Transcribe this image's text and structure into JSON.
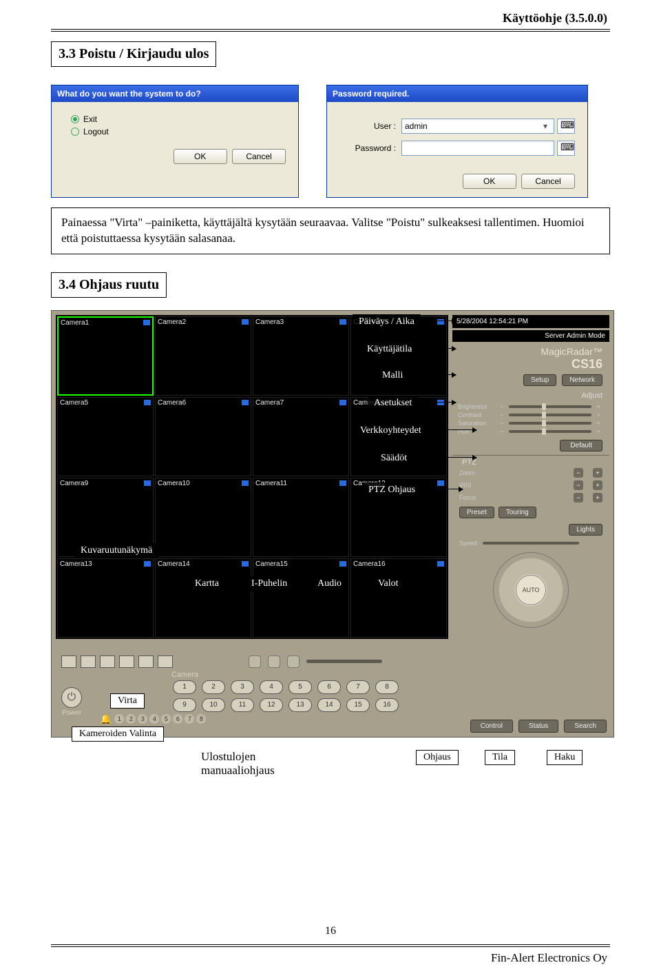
{
  "page": {
    "header": "Käyttöohje (3.5.0.0)",
    "footer": "Fin-Alert Electronics Oy",
    "number": "16"
  },
  "section1": {
    "title": "3.3 Poistu / Kirjaudu ulos"
  },
  "dialog1": {
    "title": "What do you want the system to do?",
    "opt1": "Exit",
    "opt2": "Logout",
    "ok": "OK",
    "cancel": "Cancel"
  },
  "dialog2": {
    "title": "Password required.",
    "user_label": "User :",
    "user_value": "admin",
    "pwd_label": "Password :",
    "ok": "OK",
    "cancel": "Cancel"
  },
  "paragraph": "Painaessa \"Virta\" –painiketta, käyttäjältä kysytään seuraavaa. Valitse \"Poistu\" sulkeaksesi tallentimen. Huomioi että poistuttaessa kysytään salasanaa.",
  "section2": {
    "title": "3.4 Ohjaus ruutu"
  },
  "dvr": {
    "datetime": "5/28/2004 12:54:21 PM",
    "mode": "Server Admin Mode",
    "brand1": "MagicRadar™",
    "brand2": "CS16",
    "btn_setup": "Setup",
    "btn_network": "Network",
    "adjust": "Adjust",
    "sliders": [
      "Brightness",
      "Contrast",
      "Saturation",
      "Hue"
    ],
    "default": "Default",
    "ptz": "PTZ",
    "ptz_rows": [
      "Zoom",
      "IRIS",
      "Focus"
    ],
    "pill_preset": "Preset",
    "pill_touring": "Touring",
    "pill_lights": "Lights",
    "speed": "Speed",
    "auto": "AUTO",
    "cam_label": "Camera",
    "cam_nums_top": [
      "1",
      "2",
      "3",
      "4",
      "5",
      "6",
      "7",
      "8"
    ],
    "cam_nums_bot": [
      "9",
      "10",
      "11",
      "12",
      "13",
      "14",
      "15",
      "16"
    ],
    "power": "Power",
    "bell_nums": [
      "1",
      "2",
      "3",
      "4",
      "5",
      "6",
      "7",
      "8"
    ],
    "ctrl1": "Control",
    "ctrl2": "Status",
    "ctrl3": "Search",
    "cameras": [
      "Camera1",
      "Camera2",
      "Camera3",
      "Camera4",
      "Camera5",
      "Camera6",
      "Camera7",
      "Camera8",
      "Camera9",
      "Camera10",
      "Camera11",
      "Camera12",
      "Camera13",
      "Camera14",
      "Camera15",
      "Camera16"
    ]
  },
  "callouts": {
    "paivays": "Päiväys / Aika",
    "kayttajatila": "Käyttäjätila",
    "malli": "Malli",
    "asetukset": "Asetukset",
    "verkko": "Verkkoyhteydet",
    "saadot": "Säädöt",
    "ptz": "PTZ Ohjaus",
    "kuvaruutu": "Kuvaruutunäkymä",
    "kartta": "Kartta",
    "ipuhelin": "I-Puhelin",
    "audio": "Audio",
    "valot": "Valot",
    "virta": "Virta",
    "kamvalinta": "Kameroiden Valinta",
    "ulostulo1": "Ulostulojen",
    "ulostulo2": "manuaaliohjaus",
    "ohjaus": "Ohjaus",
    "tila": "Tila",
    "haku": "Haku"
  }
}
